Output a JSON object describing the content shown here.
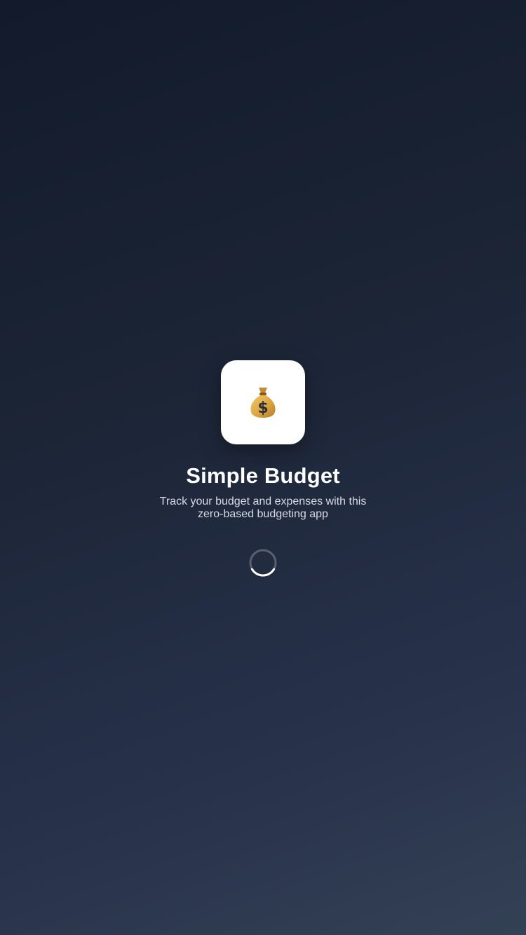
{
  "app": {
    "icon": "money-bag-icon",
    "title": "Simple Budget",
    "subtitle": "Track your budget and expenses with this zero-based budgeting app"
  },
  "loading": {
    "indicator": "spinner-icon",
    "state": "loading"
  },
  "colors": {
    "background_top": "#121a2b",
    "background_bottom": "#334155",
    "icon_tile": "#ffffff",
    "title_text": "#ffffff",
    "subtitle_text": "#d6dbe3"
  }
}
